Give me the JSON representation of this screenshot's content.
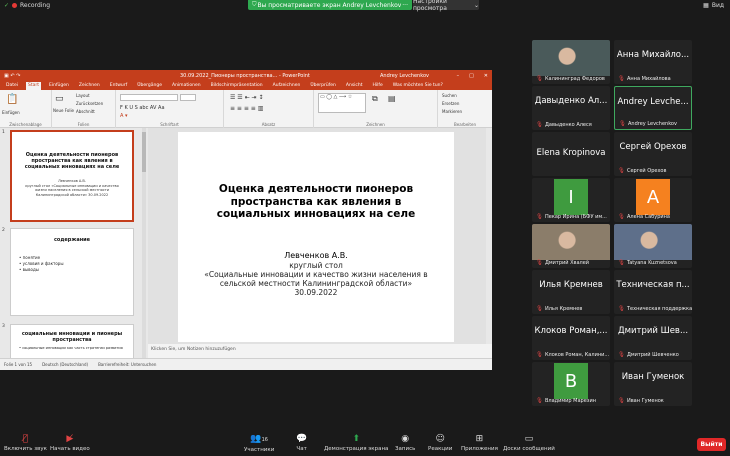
{
  "topbar": {
    "recording": "Recording",
    "share_banner": "Вы просматриваете экран Andrey Levchenkov",
    "view_settings": "Настройки просмотра",
    "view": "Вид"
  },
  "powerpoint": {
    "title": "30.09.2022_Пионеры пространства... - PowerPoint",
    "user": "Andrey Levchenkov",
    "tabs": [
      "Datei",
      "Start",
      "Einfügen",
      "Zeichnen",
      "Entwurf",
      "Übergänge",
      "Animationen",
      "Bildschirmpräsentation",
      "Aufzeichnen",
      "Überprüfen",
      "Ansicht",
      "Hilfe",
      "Was möchten Sie tun?"
    ],
    "ribbon_groups": [
      "Zwischenablage",
      "Folien",
      "Schriftart",
      "Absatz",
      "Zeichnen",
      "Bearbeiten"
    ],
    "ribbon_items": {
      "paste": "Einfügen",
      "new_slide": "Neue Folie",
      "layout": "Layout",
      "reset": "Zurücksetzen",
      "section": "Abschnitt",
      "find": "Suchen",
      "replace": "Ersetzen",
      "select": "Markieren"
    },
    "slides": [
      {
        "num": "1",
        "title": "Оценка деятельности пионеров пространства как явления в социальных инновациях на селе",
        "author": "Левченков А.В.",
        "sub": "круглый стол «Социальные инновации и качество жизни населения в сельской местности Калининградской области» 30.09.2022"
      },
      {
        "num": "2",
        "title": "содержание",
        "items": [
          "понятие",
          "условия и факторы",
          "выводы"
        ]
      },
      {
        "num": "3",
        "title": "социальные инновации и пионеры пространства",
        "items": [
          "социальные инновации как часть стратегии развития"
        ]
      }
    ],
    "main_slide": {
      "title": "Оценка деятельности пионеров пространства как явления в социальных инновациях на селе",
      "author": "Левченков А.В.",
      "line1": "круглый стол",
      "line2": "«Социальные инновации и качество жизни населения в сельской местности Калининградской области»",
      "date": "30.09.2022"
    },
    "notes": "Klicken Sie, um Notizen hinzuzufügen",
    "status": {
      "slide": "Folie 1 von 15",
      "lang": "Deutsch (Deutschland)",
      "access": "Barrierefreiheit: Untersuchen"
    }
  },
  "participants": [
    {
      "name": "",
      "label": "Калининград Федоров",
      "type": "photo",
      "color": "#4a5a5a"
    },
    {
      "name": "Анна Михайло...",
      "label": "Анна Михайлова",
      "type": "name"
    },
    {
      "name": "Давыденко Ал...",
      "label": "Давыденко Алеся",
      "type": "name"
    },
    {
      "name": "Andrey Levche...",
      "label": "Andrey Levchenkov",
      "type": "name",
      "highlight": true
    },
    {
      "name": "Elena Kropinova",
      "label": "",
      "type": "name"
    },
    {
      "name": "Сергей Орехов",
      "label": "Сергей Орехов",
      "type": "name"
    },
    {
      "name": "I",
      "label": "Пекар Ирина (БФУ им...",
      "type": "letter",
      "color": "#3f9b3f"
    },
    {
      "name": "А",
      "label": "Алена Сабурина",
      "type": "letter",
      "color": "#f5811f"
    },
    {
      "name": "",
      "label": "Дмитрий Хвалей",
      "type": "photo",
      "color": "#8b7d6a"
    },
    {
      "name": "",
      "label": "Tatyana Kuznetsova",
      "type": "photo",
      "color": "#5e6f8a"
    },
    {
      "name": "Илья Кремнев",
      "label": "Илья Кремнев",
      "type": "name"
    },
    {
      "name": "Техническая п...",
      "label": "Техническая поддержка",
      "type": "name"
    },
    {
      "name": "Клоков Роман,...",
      "label": "Клоков Роман, Калини...",
      "type": "name"
    },
    {
      "name": "Дмитрий Шев...",
      "label": "Дмитрий Шевченко",
      "type": "name"
    },
    {
      "name": "В",
      "label": "Владимир Марезин",
      "type": "letter",
      "color": "#3f9b3f"
    },
    {
      "name": "Иван Гуменок",
      "label": "Иван Гуменок",
      "type": "name"
    }
  ],
  "bottombar": {
    "buttons": [
      {
        "label": "Включить звук",
        "icon": "mic-muted-icon"
      },
      {
        "label": "Начать видео",
        "icon": "video-off-icon"
      },
      {
        "label": "Участники",
        "icon": "participants-icon",
        "count": "16"
      },
      {
        "label": "Чат",
        "icon": "chat-icon"
      },
      {
        "label": "Демонстрация экрана",
        "icon": "share-screen-icon"
      },
      {
        "label": "Запись",
        "icon": "record-icon"
      },
      {
        "label": "Реакции",
        "icon": "reactions-icon"
      },
      {
        "label": "Приложения",
        "icon": "apps-icon"
      },
      {
        "label": "Доски сообщений",
        "icon": "whiteboard-icon"
      }
    ],
    "leave": "Выйти"
  },
  "colors": {
    "ppt_accent": "#c43e1c",
    "zoom_green": "#2ea84f",
    "leave_red": "#e02828"
  }
}
